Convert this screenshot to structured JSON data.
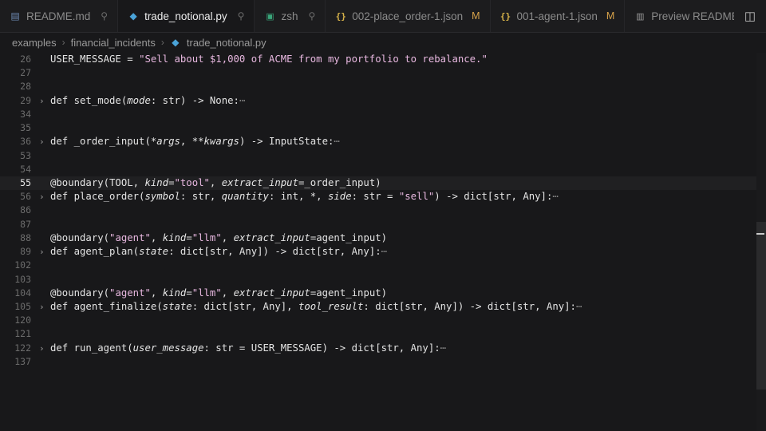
{
  "tabs": [
    {
      "label": "README.md",
      "icon": "markdown-icon",
      "pinned": true,
      "modified": false
    },
    {
      "label": "trade_notional.py",
      "icon": "python-icon",
      "pinned": true,
      "modified": false,
      "active": true
    },
    {
      "label": "zsh",
      "icon": "terminal-icon",
      "pinned": true,
      "modified": false
    },
    {
      "label": "002-place_order-1.json",
      "icon": "json-icon",
      "pinned": false,
      "modified": true,
      "badge": "M"
    },
    {
      "label": "001-agent-1.json",
      "icon": "json-icon",
      "pinned": false,
      "modified": true,
      "badge": "M"
    },
    {
      "label": "Preview README",
      "icon": "preview-icon",
      "pinned": false,
      "modified": false
    }
  ],
  "breadcrumb": [
    "examples",
    "financial_incidents",
    "trade_notional.py"
  ],
  "editor": {
    "current_line": "55",
    "lines": [
      {
        "n": "26",
        "fold": false,
        "tokens": [
          [
            "plain",
            "USER_MESSAGE = "
          ],
          [
            "str",
            "\"Sell about $1,000 of ACME from my portfolio to rebalance.\""
          ]
        ]
      },
      {
        "n": "27",
        "fold": false,
        "tokens": []
      },
      {
        "n": "28",
        "fold": false,
        "tokens": []
      },
      {
        "n": "29",
        "fold": true,
        "tokens": [
          [
            "plain",
            "def set_mode("
          ],
          [
            "par",
            "mode"
          ],
          [
            "plain",
            ": str) -> None:"
          ],
          [
            "ell",
            "⋯"
          ]
        ]
      },
      {
        "n": "34",
        "fold": false,
        "tokens": []
      },
      {
        "n": "35",
        "fold": false,
        "tokens": []
      },
      {
        "n": "36",
        "fold": true,
        "tokens": [
          [
            "plain",
            "def _order_input(*"
          ],
          [
            "par",
            "args"
          ],
          [
            "plain",
            ", **"
          ],
          [
            "par",
            "kwargs"
          ],
          [
            "plain",
            ") -> InputState:"
          ],
          [
            "ell",
            "⋯"
          ]
        ]
      },
      {
        "n": "53",
        "fold": false,
        "tokens": []
      },
      {
        "n": "54",
        "fold": false,
        "tokens": []
      },
      {
        "n": "55",
        "fold": false,
        "tokens": [
          [
            "plain",
            "@boundary(TOOL, "
          ],
          [
            "par",
            "kind"
          ],
          [
            "plain",
            "="
          ],
          [
            "str",
            "\"tool\""
          ],
          [
            "plain",
            ", "
          ],
          [
            "par",
            "extract_input"
          ],
          [
            "plain",
            "=_order_input)"
          ]
        ]
      },
      {
        "n": "56",
        "fold": true,
        "tokens": [
          [
            "plain",
            "def place_order("
          ],
          [
            "par",
            "symbol"
          ],
          [
            "plain",
            ": str, "
          ],
          [
            "par",
            "quantity"
          ],
          [
            "plain",
            ": int, *, "
          ],
          [
            "par",
            "side"
          ],
          [
            "plain",
            ": str = "
          ],
          [
            "str",
            "\"sell\""
          ],
          [
            "plain",
            ") -> dict[str, Any]:"
          ],
          [
            "ell",
            "⋯"
          ]
        ]
      },
      {
        "n": "86",
        "fold": false,
        "tokens": []
      },
      {
        "n": "87",
        "fold": false,
        "tokens": []
      },
      {
        "n": "88",
        "fold": false,
        "tokens": [
          [
            "plain",
            "@boundary("
          ],
          [
            "str",
            "\"agent\""
          ],
          [
            "plain",
            ", "
          ],
          [
            "par",
            "kind"
          ],
          [
            "plain",
            "="
          ],
          [
            "str",
            "\"llm\""
          ],
          [
            "plain",
            ", "
          ],
          [
            "par",
            "extract_input"
          ],
          [
            "plain",
            "=agent_input)"
          ]
        ]
      },
      {
        "n": "89",
        "fold": true,
        "tokens": [
          [
            "plain",
            "def agent_plan("
          ],
          [
            "par",
            "state"
          ],
          [
            "plain",
            ": dict[str, Any]) -> dict[str, Any]:"
          ],
          [
            "ell",
            "⋯"
          ]
        ]
      },
      {
        "n": "102",
        "fold": false,
        "tokens": []
      },
      {
        "n": "103",
        "fold": false,
        "tokens": []
      },
      {
        "n": "104",
        "fold": false,
        "tokens": [
          [
            "plain",
            "@boundary("
          ],
          [
            "str",
            "\"agent\""
          ],
          [
            "plain",
            ", "
          ],
          [
            "par",
            "kind"
          ],
          [
            "plain",
            "="
          ],
          [
            "str",
            "\"llm\""
          ],
          [
            "plain",
            ", "
          ],
          [
            "par",
            "extract_input"
          ],
          [
            "plain",
            "=agent_input)"
          ]
        ]
      },
      {
        "n": "105",
        "fold": true,
        "tokens": [
          [
            "plain",
            "def agent_finalize("
          ],
          [
            "par",
            "state"
          ],
          [
            "plain",
            ": dict[str, Any], "
          ],
          [
            "par",
            "tool_result"
          ],
          [
            "plain",
            ": dict[str, Any]) -> dict[str, Any]:"
          ],
          [
            "ell",
            "⋯"
          ]
        ]
      },
      {
        "n": "120",
        "fold": false,
        "tokens": []
      },
      {
        "n": "121",
        "fold": false,
        "tokens": []
      },
      {
        "n": "122",
        "fold": true,
        "tokens": [
          [
            "plain",
            "def run_agent("
          ],
          [
            "par",
            "user_message"
          ],
          [
            "plain",
            ": str = USER_MESSAGE) -> dict[str, Any]:"
          ],
          [
            "ell",
            "⋯"
          ]
        ]
      },
      {
        "n": "137",
        "fold": false,
        "tokens": []
      }
    ]
  }
}
